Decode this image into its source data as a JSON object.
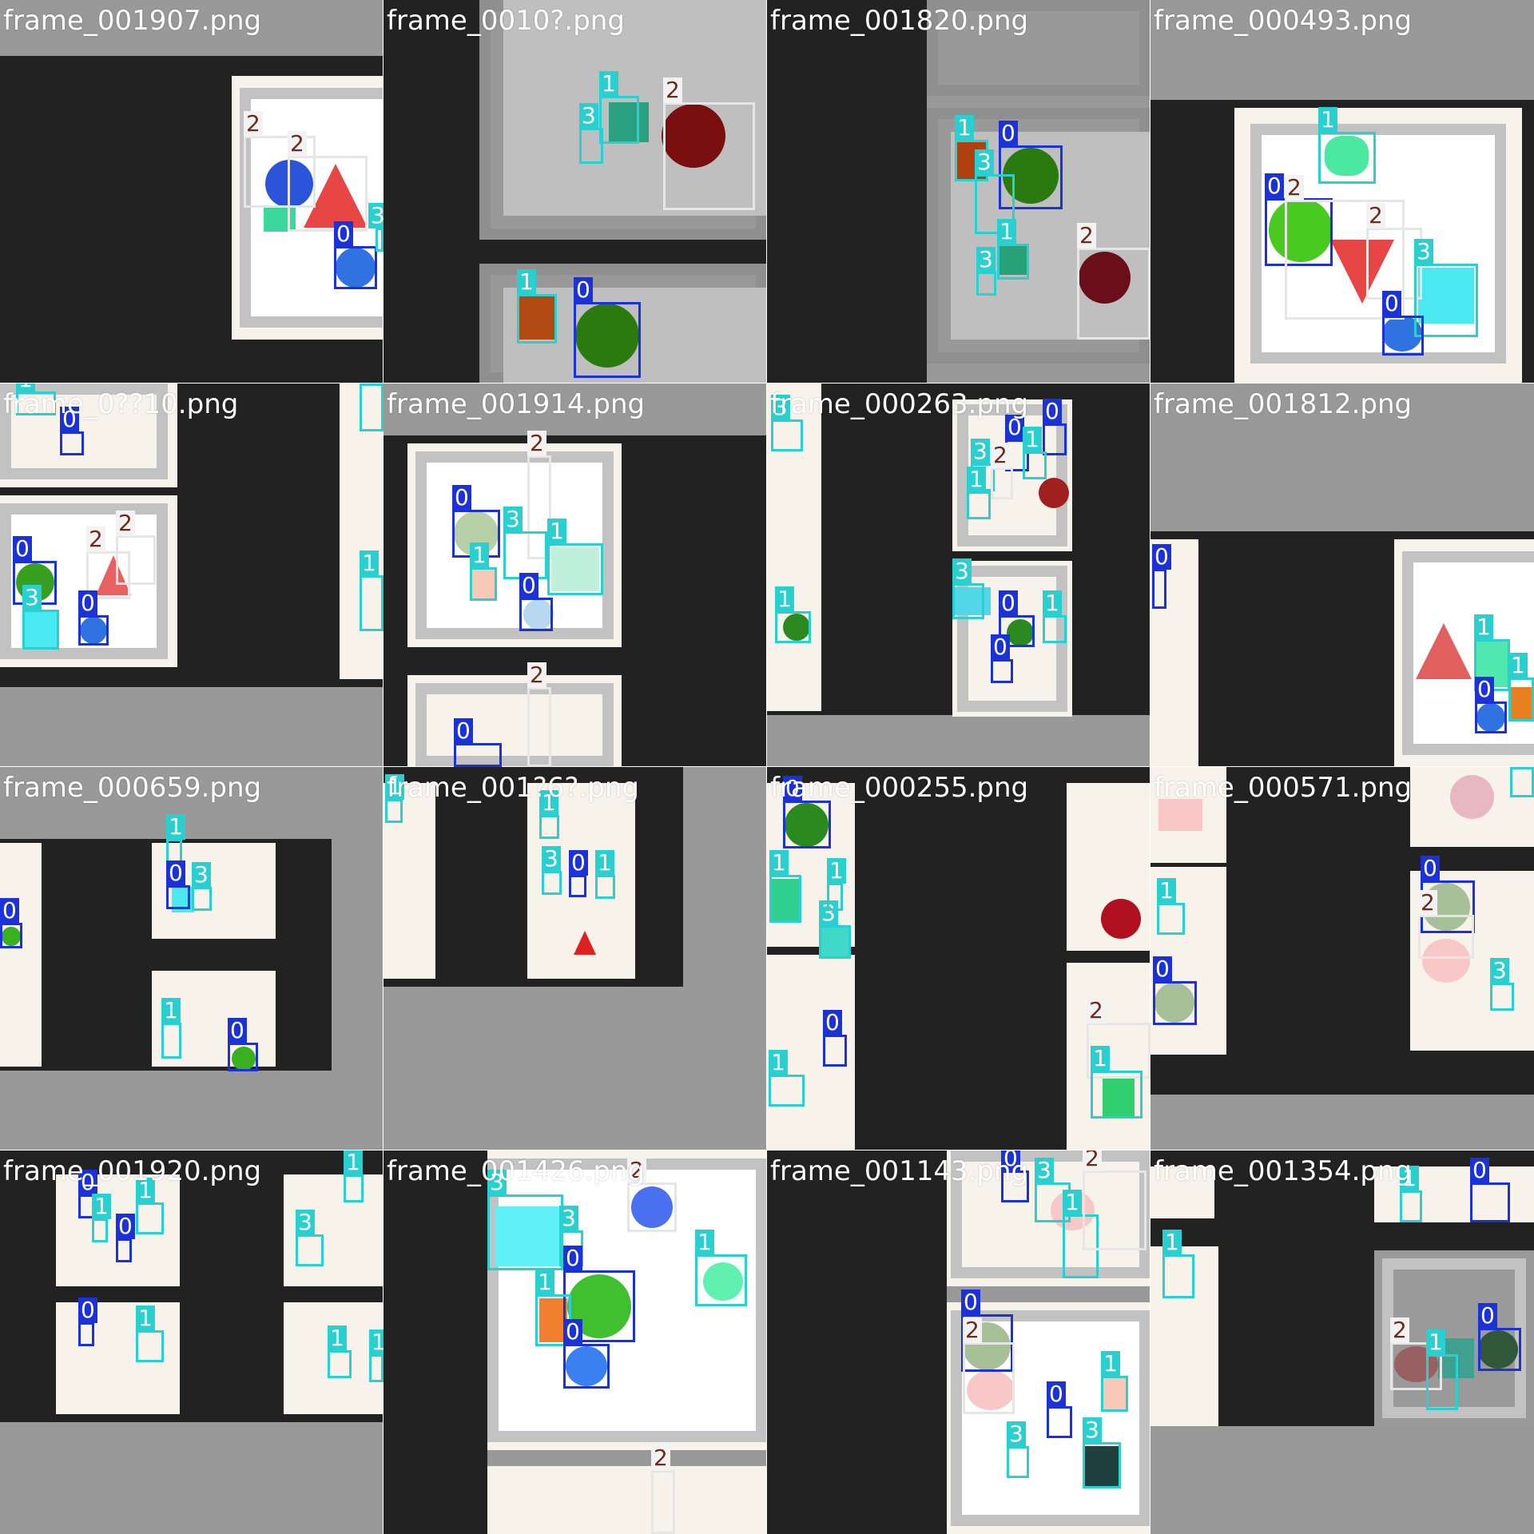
{
  "tiles": [
    {
      "name": "frame_001907.png"
    },
    {
      "name": "frame_0010?.png"
    },
    {
      "name": "frame_001820.png"
    },
    {
      "name": "frame_000493.png"
    },
    {
      "name": "frame_0??10.png"
    },
    {
      "name": "frame_001914.png"
    },
    {
      "name": "frame_000263.png"
    },
    {
      "name": "frame_001812.png"
    },
    {
      "name": "frame_000659.png"
    },
    {
      "name": "frame_001?6?.png"
    },
    {
      "name": "frame_000255.png"
    },
    {
      "name": "frame_000571.png"
    },
    {
      "name": "frame_001920.png"
    },
    {
      "name": "frame_001426.png"
    },
    {
      "name": "frame_001143.png"
    },
    {
      "name": "frame_001354.png"
    }
  ],
  "class_labels": [
    "0",
    "1",
    "2",
    "3"
  ],
  "colors": {
    "class_0": "#1a32d8",
    "class_1": "#2ad0d0",
    "class_2": "#e6e6e6",
    "class_3": "#2ad0d0",
    "background": "#222222",
    "floor": "#999999"
  }
}
